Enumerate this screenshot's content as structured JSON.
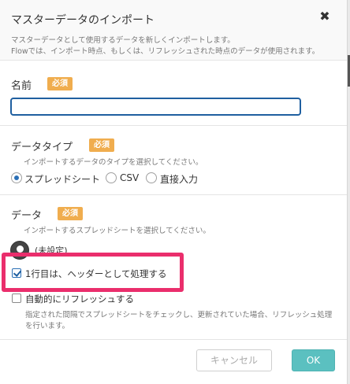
{
  "dialog": {
    "title": "マスターデータのインポート",
    "close_symbol": "✖",
    "description_line1": "マスターデータとして使用するデータを新しくインポートします。",
    "description_line2": "Flowでは、インポート時点、もしくは、リフレッシュされた時点のデータが使用されます。"
  },
  "name_section": {
    "label": "名前",
    "badge": "必須",
    "value": "",
    "placeholder": ""
  },
  "type_section": {
    "label": "データタイプ",
    "badge": "必須",
    "description": "インポートするデータのタイプを選択してください。",
    "options": [
      {
        "label": "スプレッドシート",
        "selected": true
      },
      {
        "label": "CSV",
        "selected": false
      },
      {
        "label": "直接入力",
        "selected": false
      }
    ]
  },
  "data_section": {
    "label": "データ",
    "badge": "必須",
    "description": "インポートするスプレッドシートを選択してください。",
    "sheet_status": "(未設定)",
    "header_checkbox": {
      "label": "1行目は、ヘッダーとして処理する",
      "checked": true
    },
    "refresh_checkbox": {
      "label": "自動的にリフレッシュする",
      "checked": false
    },
    "refresh_help_line1": "指定された間隔でスプレッドシートをチェックし、更新されていた場合、リフレッシュ処理",
    "refresh_help_line2": "を行います。"
  },
  "footer": {
    "cancel_label": "キャンセル",
    "ok_label": "OK"
  },
  "colors": {
    "badge": "#f0ad4e",
    "highlight": "#ea2e6c",
    "ok_button": "#5bc0c0",
    "input_focus": "#1f5fa0"
  }
}
